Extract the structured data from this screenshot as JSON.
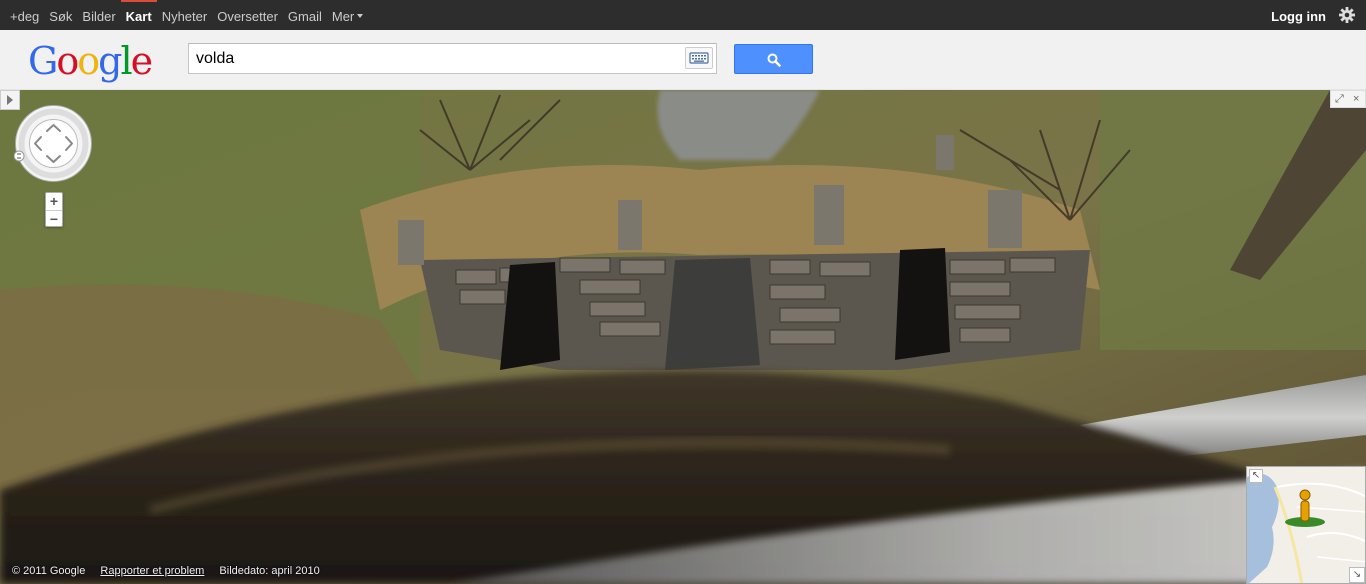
{
  "topbar": {
    "nav": [
      {
        "label": "+deg",
        "active": false
      },
      {
        "label": "Søk",
        "active": false
      },
      {
        "label": "Bilder",
        "active": false
      },
      {
        "label": "Kart",
        "active": true
      },
      {
        "label": "Nyheter",
        "active": false
      },
      {
        "label": "Oversetter",
        "active": false
      },
      {
        "label": "Gmail",
        "active": false
      },
      {
        "label": "Mer",
        "active": false
      }
    ],
    "login_label": "Logg inn",
    "settings_icon": "gear-icon"
  },
  "header": {
    "logo_letters": [
      {
        "ch": "G",
        "color": "#3369e8"
      },
      {
        "ch": "o",
        "color": "#d50f25"
      },
      {
        "ch": "o",
        "color": "#eeb211"
      },
      {
        "ch": "g",
        "color": "#3369e8"
      },
      {
        "ch": "l",
        "color": "#009925"
      },
      {
        "ch": "e",
        "color": "#d50f25"
      }
    ],
    "search_value": "volda",
    "keyboard_icon": "keyboard-icon",
    "search_button_icon": "magnifier-icon"
  },
  "streetview": {
    "zoom_in": "+",
    "zoom_out": "−",
    "fullscreen_icon": "expand-icon",
    "close_icon": "×",
    "footer": {
      "copyright": "© 2011 Google",
      "report": "Rapporter et problem",
      "date": "Bildedato: april 2010"
    },
    "minimap": {
      "pegman_icon": "pegman-icon"
    }
  },
  "colors": {
    "accent": "#dd4b39",
    "search_button": "#4d90fe",
    "topbar": "#2d2d2d"
  }
}
